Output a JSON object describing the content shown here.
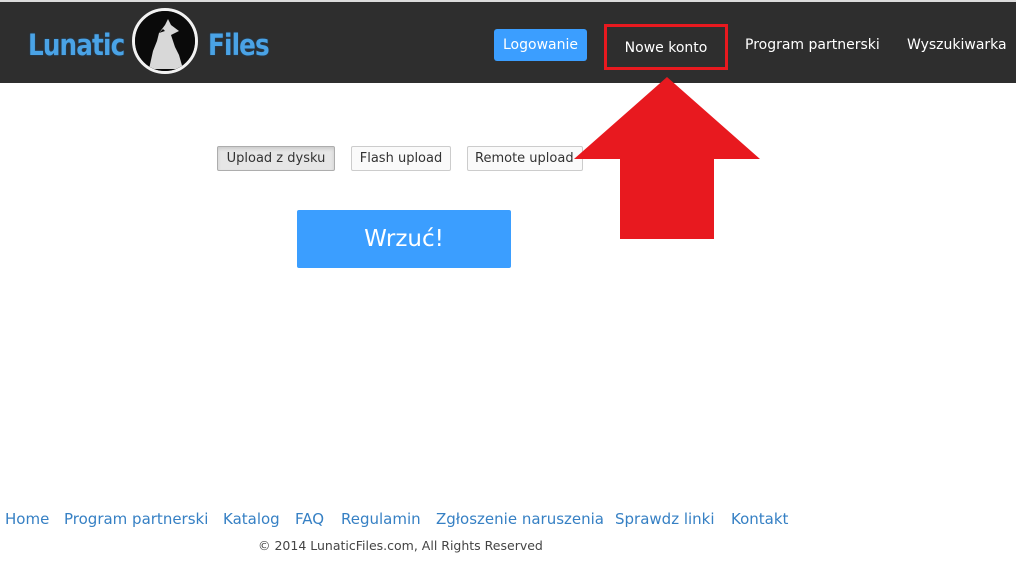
{
  "header": {
    "logo": {
      "left_text": "Lunatic",
      "right_text": "Files",
      "icon": "wolf-howling-icon"
    },
    "nav": {
      "login": "Logowanie",
      "new_account": "Nowe konto",
      "partner": "Program partnerski",
      "search": "Wyszukiwarka"
    }
  },
  "upload": {
    "tabs": [
      "Upload z dysku",
      "Flash upload",
      "Remote upload"
    ],
    "active_tab": "Upload z dysku",
    "submit": "Wrzuć!"
  },
  "annotation": {
    "icon": "red-arrow-up-icon",
    "color": "#e8191f"
  },
  "footer": {
    "links": [
      "Home",
      "Program partnerski",
      "Katalog",
      "FAQ",
      "Regulamin",
      "Zgłoszenie naruszenia",
      "Sprawdz linki",
      "Kontakt"
    ],
    "copyright": "© 2014 LunaticFiles.com, All Rights Reserved"
  },
  "colors": {
    "navbar": "#2e2e2e",
    "accent": "#3b9eff",
    "link": "#3680c4",
    "highlight": "#e8191f"
  }
}
